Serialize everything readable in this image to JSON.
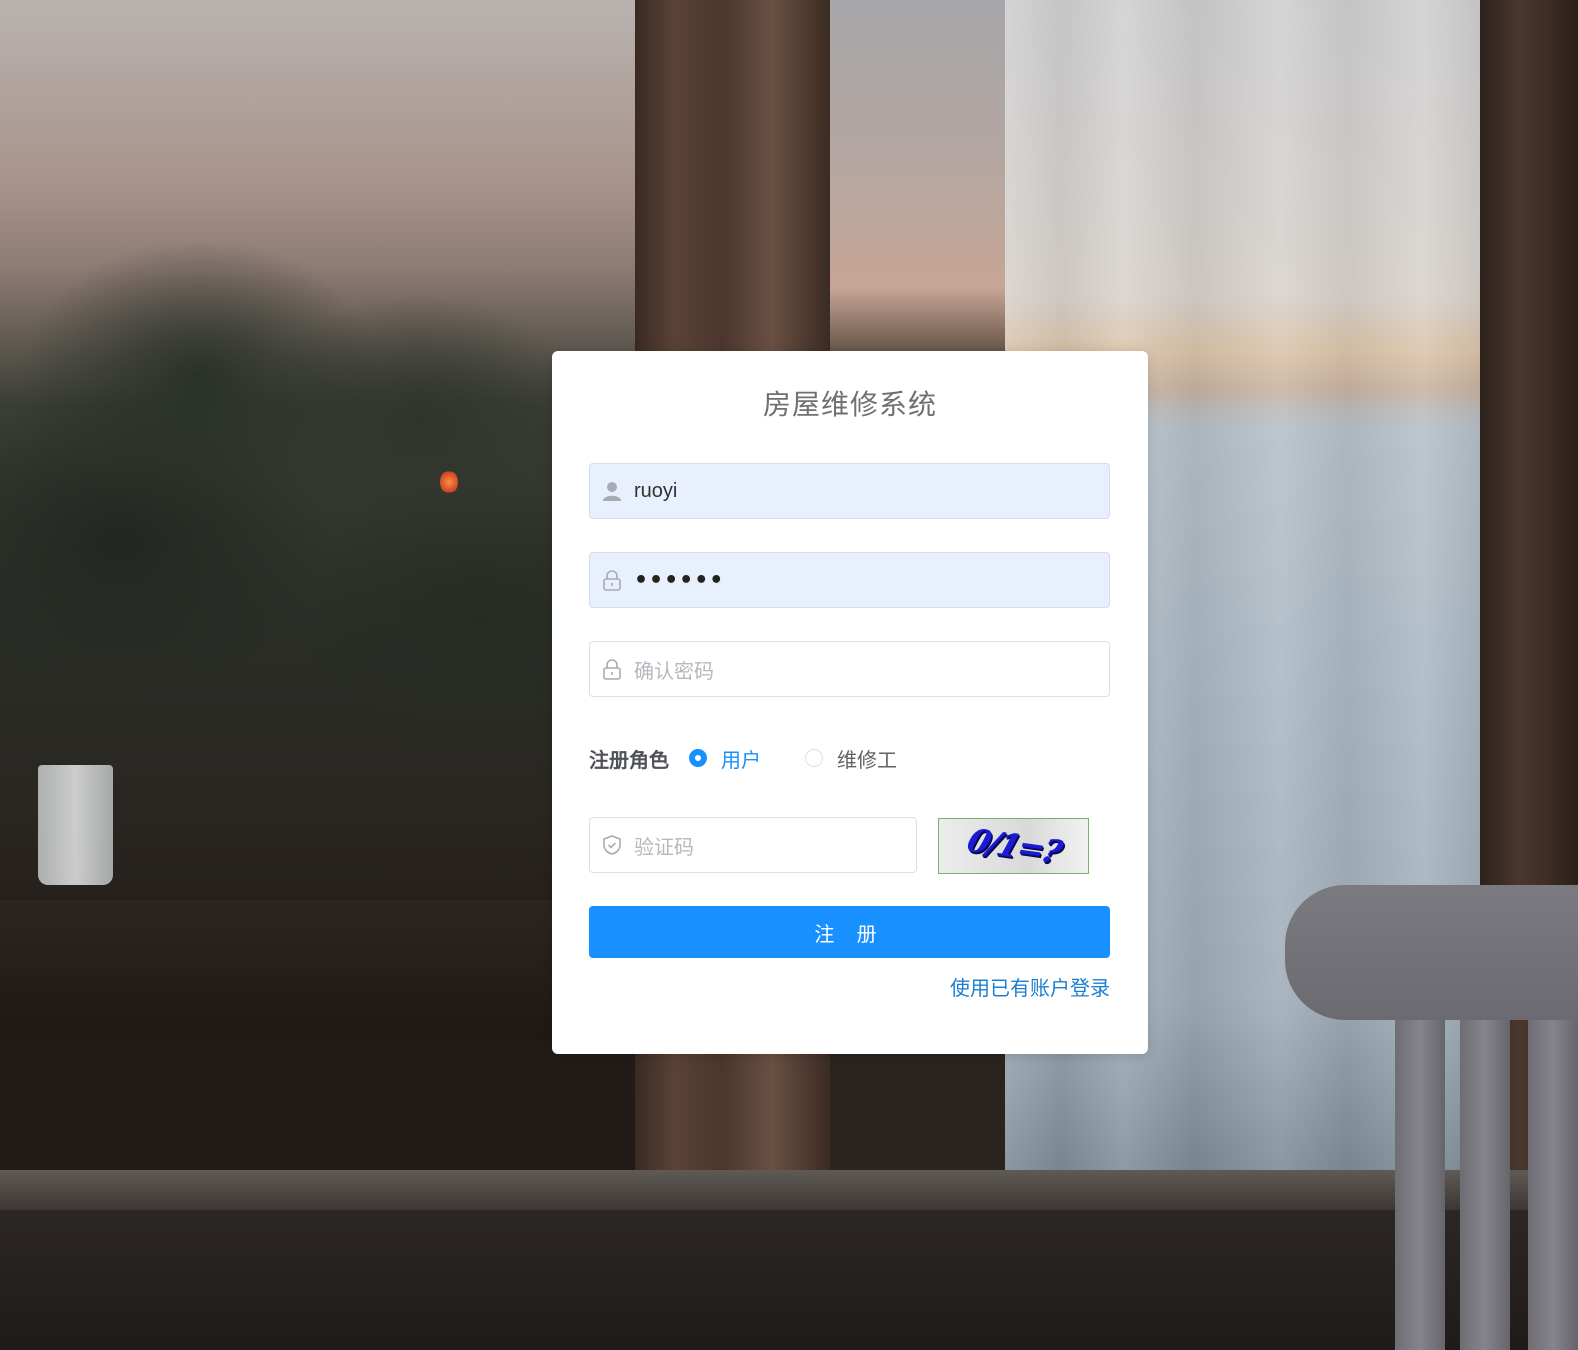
{
  "background": {
    "description_icon": "photo-background"
  },
  "form": {
    "title": "房屋维修系统",
    "username": {
      "value": "ruoyi",
      "icon": "user-icon"
    },
    "password": {
      "value": "••••••",
      "icon": "lock-icon"
    },
    "confirm_password": {
      "placeholder": "确认密码",
      "icon": "lock-icon"
    },
    "role": {
      "label": "注册角色",
      "options": [
        {
          "label": "用户",
          "checked": true
        },
        {
          "label": "维修工",
          "checked": false
        }
      ]
    },
    "captcha": {
      "placeholder": "验证码",
      "icon": "shield-icon",
      "image_text": "0/1=?"
    },
    "submit_label": "注 册",
    "login_link": "使用已有账户登录"
  },
  "colors": {
    "primary": "#1890ff",
    "autofill": "#e8f0fe",
    "link": "#1c7fd0"
  }
}
